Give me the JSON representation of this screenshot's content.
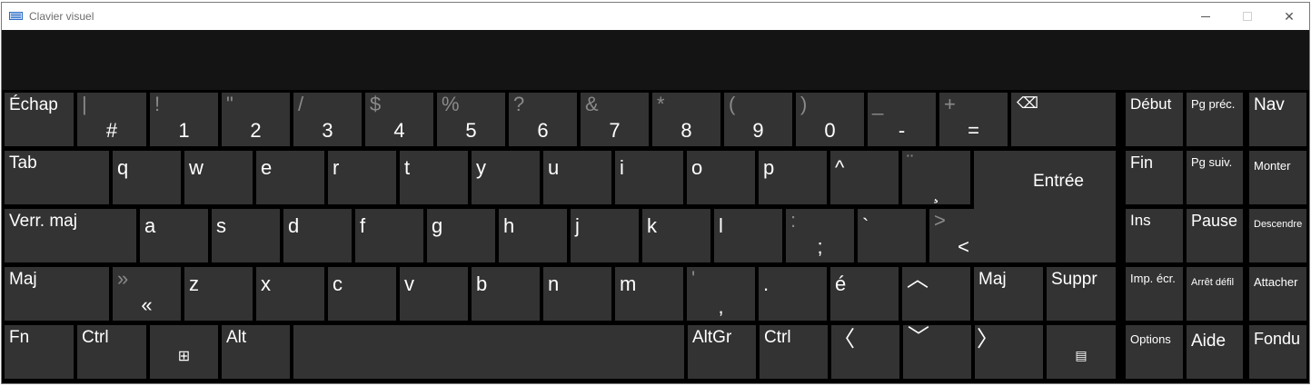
{
  "window": {
    "title": "Clavier visuel",
    "minimize": "—",
    "close": "✕"
  },
  "keys": {
    "esc": "Échap",
    "n1_sec": "|",
    "n1_pri": "#",
    "n2_sec": "!",
    "n2_pri": "1",
    "n3_sec": "\"",
    "n3_pri": "2",
    "n4_sec": "/",
    "n4_pri": "3",
    "n5_sec": "$",
    "n5_pri": "4",
    "n6_sec": "%",
    "n6_pri": "5",
    "n7_sec": "?",
    "n7_pri": "6",
    "n8_sec": "&",
    "n8_pri": "7",
    "n9_sec": "*",
    "n9_pri": "8",
    "n10_sec": "(",
    "n10_pri": "9",
    "n11_sec": ")",
    "n11_pri": "0",
    "n12_sec": "_",
    "n12_pri": "-",
    "n13_sec": "+",
    "n13_pri": "=",
    "backspace": "⌫",
    "tab": "Tab",
    "q": "q",
    "w": "w",
    "e": "e",
    "r": "r",
    "t": "t",
    "y": "y",
    "u": "u",
    "i": "i",
    "o": "o",
    "p": "p",
    "caret": "^",
    "diaeresis_sec": "¨",
    "diaeresis_pri": "¸",
    "enter": "Entrée",
    "capslock": "Verr. maj",
    "a": "a",
    "s": "s",
    "d": "d",
    "f": "f",
    "g": "g",
    "h": "h",
    "j": "j",
    "k": "k",
    "l": "l",
    "semicolon_sec": ":",
    "semicolon_pri": ";",
    "backtick": "`",
    "lt_sec": ">",
    "lt_pri": "<",
    "shift_left": "Maj",
    "guillemet_sec": "»",
    "guillemet_pri": "«",
    "z": "z",
    "x": "x",
    "c": "c",
    "v": "v",
    "b": "b",
    "n": "n",
    "m": "m",
    "comma_sec": "'",
    "comma_pri": ",",
    "period": ".",
    "eacute": "é",
    "up": "︿",
    "shift_right": "Maj",
    "delete": "Suppr",
    "fn": "Fn",
    "ctrl_left": "Ctrl",
    "win": "⊞",
    "alt": "Alt",
    "space": "",
    "altgr": "AltGr",
    "ctrl_right": "Ctrl",
    "left": "〈",
    "down": "﹀",
    "right": "〉",
    "menu": "▤",
    "home": "Début",
    "pgup": "Pg préc.",
    "nav": "Nav",
    "end": "Fin",
    "pgdn": "Pg suiv.",
    "scrollup": "Monter",
    "insert": "Ins",
    "pause": "Pause",
    "scrolldown": "Descendre",
    "prtscr": "Imp. écr.",
    "scrlk": "Arrêt défil",
    "dock": "Attacher",
    "options": "Options",
    "help": "Aide",
    "fade": "Fondu"
  }
}
